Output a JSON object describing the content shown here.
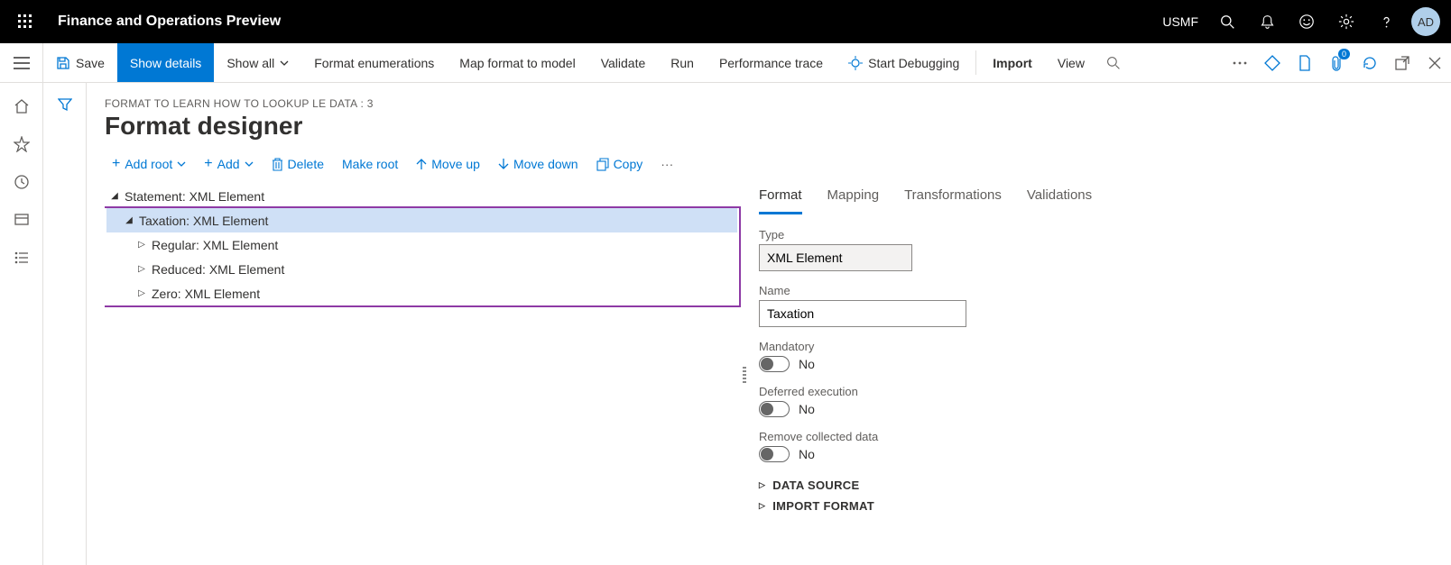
{
  "header": {
    "app_title": "Finance and Operations Preview",
    "company": "USMF",
    "avatar_initials": "AD"
  },
  "cmdbar": {
    "save": "Save",
    "show_details": "Show details",
    "show_all": "Show all",
    "format_enum": "Format enumerations",
    "map_format": "Map format to model",
    "validate": "Validate",
    "run": "Run",
    "perf_trace": "Performance trace",
    "start_debug": "Start Debugging",
    "import": "Import",
    "view": "View",
    "attach_count": "0"
  },
  "page": {
    "breadcrumb": "FORMAT TO LEARN HOW TO LOOKUP LE DATA : 3",
    "title": "Format designer"
  },
  "toolbar2": {
    "add_root": "Add root",
    "add": "Add",
    "delete": "Delete",
    "make_root": "Make root",
    "move_up": "Move up",
    "move_down": "Move down",
    "copy": "Copy"
  },
  "tree": {
    "n0": "Statement: XML Element",
    "n1": "Taxation: XML Element",
    "n2": "Regular: XML Element",
    "n3": "Reduced: XML Element",
    "n4": "Zero: XML Element"
  },
  "tabs": {
    "format": "Format",
    "mapping": "Mapping",
    "transformations": "Transformations",
    "validations": "Validations"
  },
  "props": {
    "type_label": "Type",
    "type_value": "XML Element",
    "name_label": "Name",
    "name_value": "Taxation",
    "mandatory_label": "Mandatory",
    "mandatory_value": "No",
    "deferred_label": "Deferred execution",
    "deferred_value": "No",
    "remove_label": "Remove collected data",
    "remove_value": "No",
    "datasource": "DATA SOURCE",
    "import_format": "IMPORT FORMAT"
  }
}
